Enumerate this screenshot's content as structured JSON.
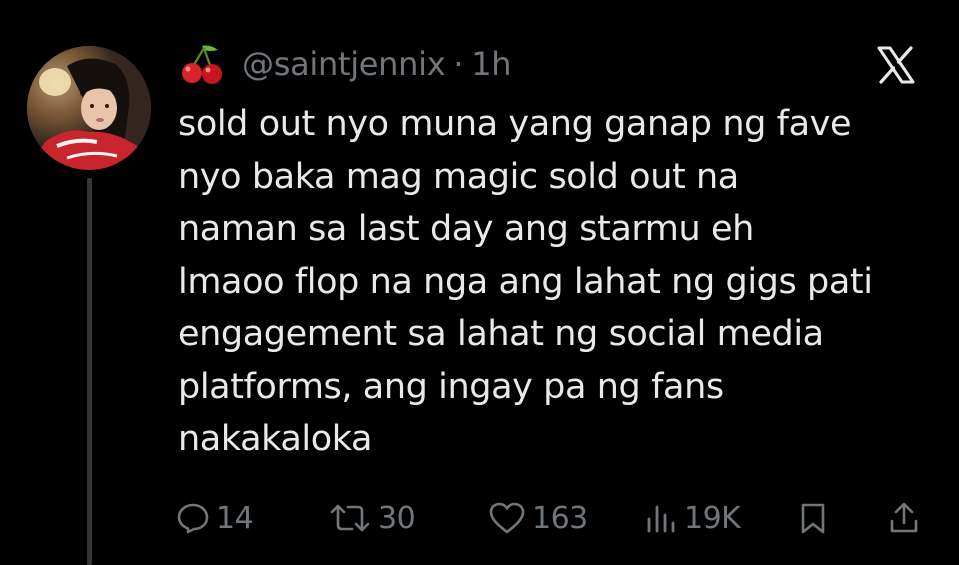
{
  "author": {
    "handle": "@saintjennix",
    "separator": "·",
    "time": "1h",
    "name_emoji_icon": "cherries-emoji"
  },
  "tweet": {
    "lines": [
      "sold out nyo muna yang ganap ng fave",
      "nyo baka mag magic sold out na",
      "naman sa last day ang starmu eh",
      "lmaoo flop na nga ang lahat ng gigs pati",
      "engagement sa lahat ng social media",
      "platforms, ang ingay pa ng fans",
      "nakakaloka"
    ]
  },
  "actions": {
    "replies": "14",
    "reposts": "30",
    "likes": "163",
    "views": "19K"
  },
  "icons": {
    "reply": "reply-icon",
    "repost": "repost-icon",
    "like": "heart-icon",
    "views": "views-icon",
    "bookmark": "bookmark-icon",
    "share": "share-icon",
    "brand": "x-logo-icon"
  },
  "colors": {
    "background": "#000000",
    "text": "#e7e9ea",
    "muted": "#71767b",
    "thread_line": "#333639"
  }
}
